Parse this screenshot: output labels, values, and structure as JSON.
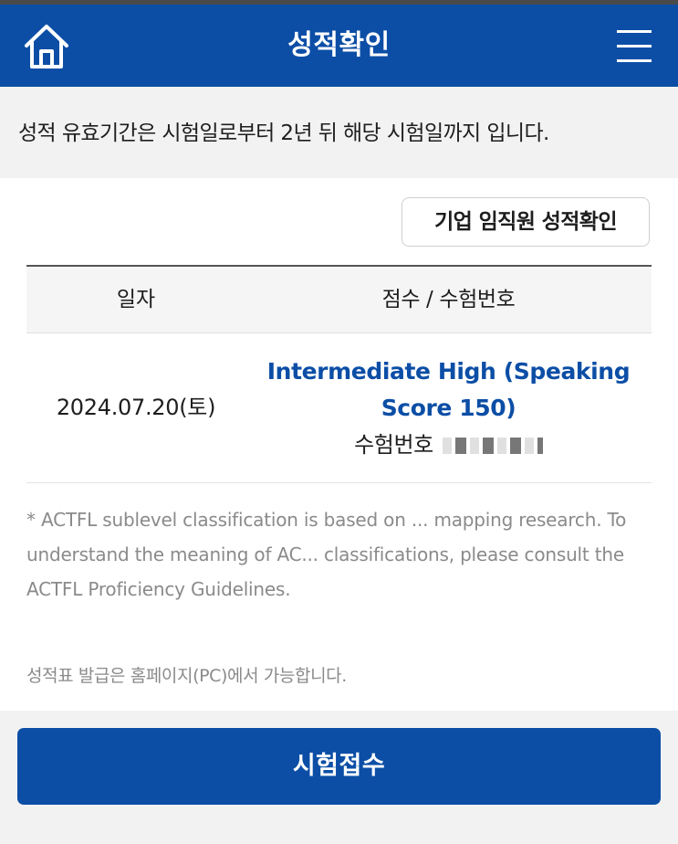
{
  "header": {
    "title": "성적확인",
    "home_icon": "home-icon",
    "menu_icon": "hamburger-menu-icon",
    "background_color": "#0c4ea6"
  },
  "notice": {
    "text": "성적 유효기간은 시험일로부터 2년 뒤 해당 시험일까지 입니다."
  },
  "corporate_button": {
    "label": "기업 임직원 성적확인"
  },
  "table": {
    "headers": [
      "일자",
      "점수 / 수험번호"
    ],
    "rows": [
      {
        "date": "2024.07.20(토)",
        "score": "Intermediate High (Speaking Score 150)",
        "exam_number_label": "수험번호"
      }
    ]
  },
  "footnote": {
    "text": "* ACTFL sublevel classification is based on ... mapping research. To understand the meaning of AC... classifications, please consult the ACTFL Proficiency Guidelines.",
    "issue_note": "성적표 발급은 홈페이지(PC)에서 가능합니다."
  },
  "apply_button": {
    "label": "시험접수"
  },
  "colors": {
    "accent": "#0c4ea6",
    "muted_text": "#8a8a8a"
  }
}
